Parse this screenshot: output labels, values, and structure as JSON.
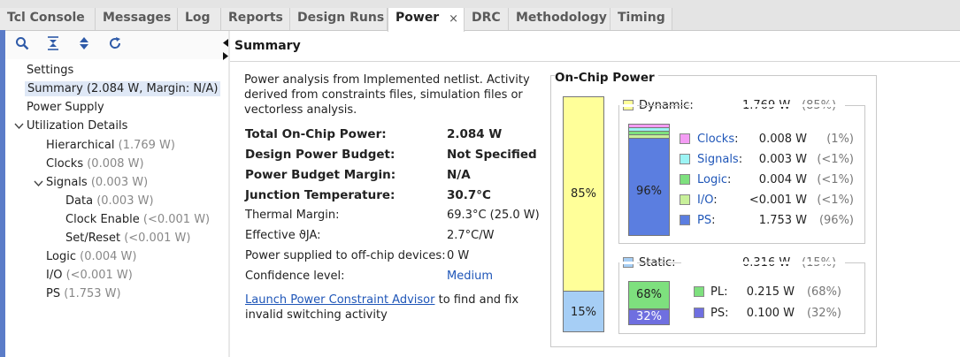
{
  "tabs": [
    {
      "label": "Tcl Console",
      "active": false
    },
    {
      "label": "Messages",
      "active": false
    },
    {
      "label": "Log",
      "active": false
    },
    {
      "label": "Reports",
      "active": false
    },
    {
      "label": "Design Runs",
      "active": false
    },
    {
      "label": "Power",
      "active": true
    },
    {
      "label": "DRC",
      "active": false
    },
    {
      "label": "Methodology",
      "active": false
    },
    {
      "label": "Timing",
      "active": false
    }
  ],
  "close_glyph": "×",
  "toolbar": {
    "search_icon": "search-icon",
    "collapse_icon": "collapse-all-icon",
    "expand_icon": "expand-all-icon",
    "refresh_icon": "refresh-icon"
  },
  "nav": {
    "settings": "Settings",
    "summary": "Summary (2.084 W, Margin: N/A)",
    "power_supply": "Power Supply",
    "utilization": "Utilization Details",
    "hierarchical": {
      "label": "Hierarchical",
      "value": "(1.769 W)"
    },
    "clocks": {
      "label": "Clocks",
      "value": "(0.008 W)"
    },
    "signals": {
      "label": "Signals",
      "value": "(0.003 W)"
    },
    "data": {
      "label": "Data",
      "value": "(0.003 W)"
    },
    "clock_enable": {
      "label": "Clock Enable",
      "value": "(<0.001 W)"
    },
    "set_reset": {
      "label": "Set/Reset",
      "value": "(<0.001 W)"
    },
    "logic": {
      "label": "Logic",
      "value": "(0.004 W)"
    },
    "io": {
      "label": "I/O",
      "value": "(<0.001 W)"
    },
    "ps": {
      "label": "PS",
      "value": "(1.753 W)"
    }
  },
  "summary": {
    "title": "Summary",
    "intro_line1": "Power analysis from Implemented netlist. Activity",
    "intro_line2": "derived from constraints files, simulation files or",
    "intro_line3": "vectorless analysis.",
    "rows": [
      {
        "label": "Total On-Chip Power:",
        "value": "2.084 W",
        "bold": true
      },
      {
        "label": "Design Power Budget:",
        "value": "Not Specified",
        "bold": true
      },
      {
        "label": "Power Budget Margin:",
        "value": "N/A",
        "bold": true
      },
      {
        "label": "Junction Temperature:",
        "value": "30.7°C",
        "bold": true
      },
      {
        "label": "Thermal Margin:",
        "value": "69.3°C (25.0 W)",
        "bold": false
      },
      {
        "label": "Effective ϑJA:",
        "value": "2.7°C/W",
        "bold": false
      },
      {
        "label": "Power supplied to off-chip devices:",
        "value": "0 W",
        "bold": false
      },
      {
        "label": "Confidence level:",
        "value": "Medium",
        "bold": false,
        "link": true
      }
    ],
    "advisor_link": "Launch Power Constraint Advisor",
    "advisor_rest": "to find and fix",
    "advisor_line2": "invalid switching activity"
  },
  "chart": {
    "title": "On-Chip Power",
    "dynamic_pct_label": "85%",
    "static_pct_label": "15%",
    "dynamic": {
      "label": "Dynamic:",
      "value": "1.769 W",
      "pct": "(85%)",
      "color": "#ffff99"
    },
    "static": {
      "label": "Static:",
      "value": "0.316 W",
      "pct": "(15%)",
      "color": "#a6cef5"
    },
    "dynamic_inner_label": "96%",
    "dynamic_items": [
      {
        "label": "Clocks",
        "value": "0.008 W",
        "pct": "(1%)",
        "color": "#f49cf4",
        "link": true,
        "colon": ":"
      },
      {
        "label": "Signals",
        "value": "0.003 W",
        "pct": "(<1%)",
        "color": "#9cf4f4",
        "link": true,
        "colon": ":"
      },
      {
        "label": "Logic",
        "value": "0.004 W",
        "pct": "(<1%)",
        "color": "#7ee07e",
        "link": true,
        "colon": ":"
      },
      {
        "label": "I/O",
        "value": "<0.001 W",
        "pct": "(<1%)",
        "color": "#c8f09a",
        "link": true,
        "colon": ":"
      },
      {
        "label": "PS",
        "value": "1.753 W",
        "pct": "(96%)",
        "color": "#5b7ee0",
        "link": true,
        "colon": ":"
      }
    ],
    "static_inner_top": "68%",
    "static_inner_bottom": "32%",
    "static_items": [
      {
        "label": "PL:",
        "value": "0.215 W",
        "pct": "(68%)",
        "color": "#7ee07e"
      },
      {
        "label": "PS:",
        "value": "0.100 W",
        "pct": "(32%)",
        "color": "#6f6fe0"
      }
    ]
  },
  "chart_data": {
    "type": "bar",
    "title": "On-Chip Power",
    "series": [
      {
        "name": "Dynamic",
        "values": [
          1.769
        ],
        "percent": 85
      },
      {
        "name": "Static",
        "values": [
          0.316
        ],
        "percent": 15
      }
    ],
    "dynamic_breakdown": {
      "Clocks": 0.008,
      "Signals": 0.003,
      "Logic": 0.004,
      "I/O": 0.001,
      "PS": 1.753
    },
    "static_breakdown": {
      "PL": 0.215,
      "PS": 0.1
    }
  }
}
